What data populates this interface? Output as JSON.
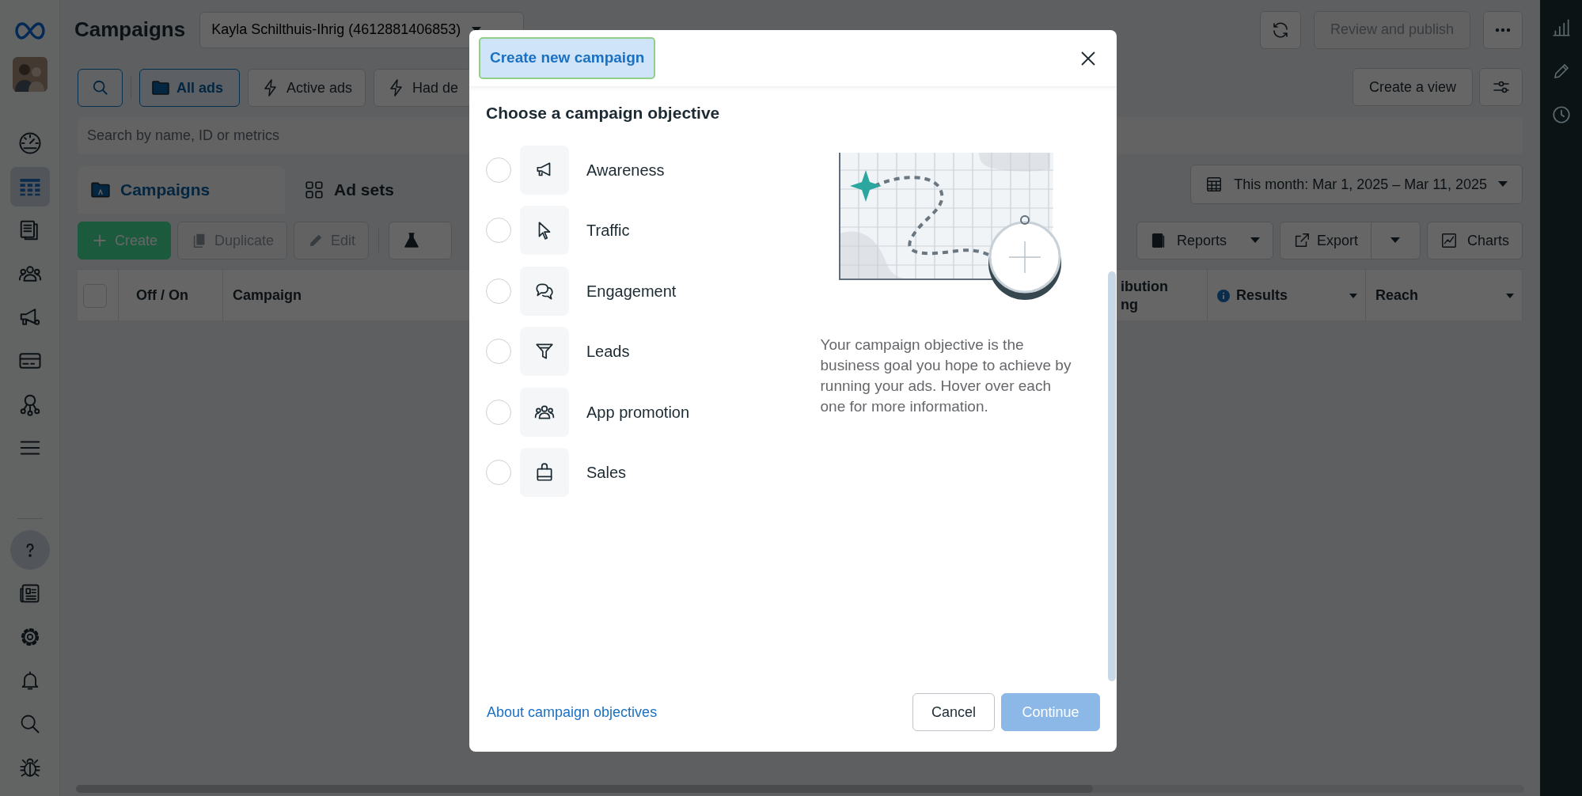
{
  "app": {
    "title": "Campaigns",
    "account": "Kayla Schilthuis-Ihrig (4612881406853)"
  },
  "nav_top": [
    {
      "selected": false
    },
    {
      "selected": true
    },
    {
      "selected": false
    },
    {
      "selected": false
    },
    {
      "selected": false
    },
    {
      "selected": false
    },
    {
      "selected": false
    },
    {
      "selected": false
    }
  ],
  "nav_bottom": [
    {
      "selected": true
    },
    {
      "selected": false
    },
    {
      "selected": false
    },
    {
      "selected": false
    },
    {
      "selected": false
    },
    {
      "selected": false
    }
  ],
  "top_actions": {
    "publish": {
      "label": "Review and publish",
      "disabled": true
    }
  },
  "filters": [
    {
      "label": "All ads",
      "selected": true
    },
    {
      "label": "Active ads",
      "selected": false
    },
    {
      "label": "Had de",
      "selected": false
    }
  ],
  "view_button": "Create a view",
  "search": {
    "placeholder": "Search by name, ID or metrics"
  },
  "level_tabs": [
    {
      "label": "Campaigns",
      "selected": true
    },
    {
      "label": "Ad sets",
      "selected": false
    }
  ],
  "date_range": "This month: Mar 1, 2025 – Mar 11, 2025",
  "toolbar_left": [
    {
      "label": "Create",
      "kind": "primary",
      "disabled": false
    },
    {
      "label": "Duplicate",
      "kind": "plain",
      "disabled": true
    },
    {
      "label": "Edit",
      "kind": "plain",
      "disabled": true
    }
  ],
  "toolbar_right": [
    {
      "label": "Reports",
      "kind": "menu"
    },
    {
      "label": "Export",
      "kind": "split"
    },
    {
      "label": "Charts",
      "kind": "plain"
    }
  ],
  "table": {
    "select_all": {
      "checked": false
    },
    "columns_left": [
      "Off / On",
      "Campaign"
    ],
    "columns_right": [
      {
        "label": "ibution ng",
        "kind": "plain"
      },
      {
        "label": "Results",
        "kind": "info"
      },
      {
        "label": "Reach",
        "kind": "sort"
      }
    ]
  },
  "dialog": {
    "title": "Create new campaign",
    "heading": "Choose a campaign objective",
    "objectives": [
      {
        "label": "Awareness",
        "selected": false
      },
      {
        "label": "Traffic",
        "selected": false
      },
      {
        "label": "Engagement",
        "selected": false
      },
      {
        "label": "Leads",
        "selected": false
      },
      {
        "label": "App promotion",
        "selected": false
      },
      {
        "label": "Sales",
        "selected": false
      }
    ],
    "description": "Your campaign objective is the business goal you hope to achieve by running your ads. Hover over each one for more information.",
    "link": "About campaign objectives",
    "buttons": [
      {
        "label": "Cancel",
        "kind": "secondary",
        "disabled": false
      },
      {
        "label": "Continue",
        "kind": "primary",
        "disabled": true
      }
    ]
  }
}
